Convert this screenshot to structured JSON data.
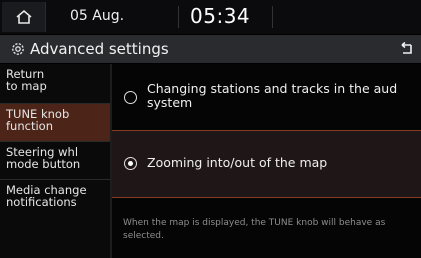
{
  "status": {
    "date": "05 Aug.",
    "time": "05:34",
    "home_icon": "home-icon"
  },
  "header": {
    "title": "Advanced settings",
    "settings_icon": "gear-icon",
    "back_icon": "back-arrow-icon"
  },
  "sidebar": {
    "items": [
      {
        "label": "Return to map",
        "line1": "Return",
        "line2": "to map"
      },
      {
        "label": "TUNE knob function",
        "line1": "TUNE knob",
        "line2": "function",
        "active": true
      },
      {
        "label": "Steering whl mode button",
        "line1": "Steering whl",
        "line2": "mode button"
      },
      {
        "label": "Media change notifications",
        "line1": "Media change",
        "line2": "notifications"
      }
    ]
  },
  "main": {
    "options": [
      {
        "line1": "Changing stations and tracks in the aud",
        "line2": "system",
        "selected": false
      },
      {
        "line1": "Zooming into/out of the map",
        "selected": true
      }
    ],
    "help": "When the map is displayed, the TUNE knob will behave as selected."
  },
  "colors": {
    "accent": "#8a3a24",
    "active_bg": "#4d2418"
  }
}
